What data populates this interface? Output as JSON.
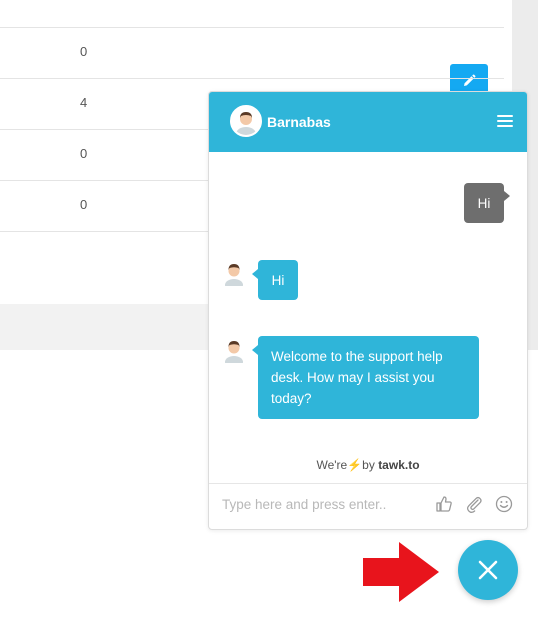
{
  "table": {
    "rows": [
      {
        "count": "0"
      },
      {
        "count": "4"
      },
      {
        "count": "0"
      },
      {
        "count": "0"
      }
    ]
  },
  "chat": {
    "agent_name": "Barnabas",
    "messages": [
      {
        "from": "visitor",
        "text": "Hi"
      },
      {
        "from": "agent",
        "text": "Hi"
      },
      {
        "from": "agent",
        "text": "Welcome to the support help desk. How may I assist you today?"
      }
    ],
    "powered_prefix": "We're",
    "powered_by": "by",
    "powered_brand": "tawk.to",
    "input_placeholder": "Type here and press enter..",
    "icons": [
      "menu-icon",
      "thumbs-up-icon",
      "attachment-icon",
      "emoji-icon",
      "close-icon",
      "pencil-icon"
    ]
  },
  "colors": {
    "accent": "#2fb5d9",
    "edit_button": "#14a9f2",
    "visitor_bubble": "#6e6e6e",
    "arrow": "#e8141c"
  }
}
